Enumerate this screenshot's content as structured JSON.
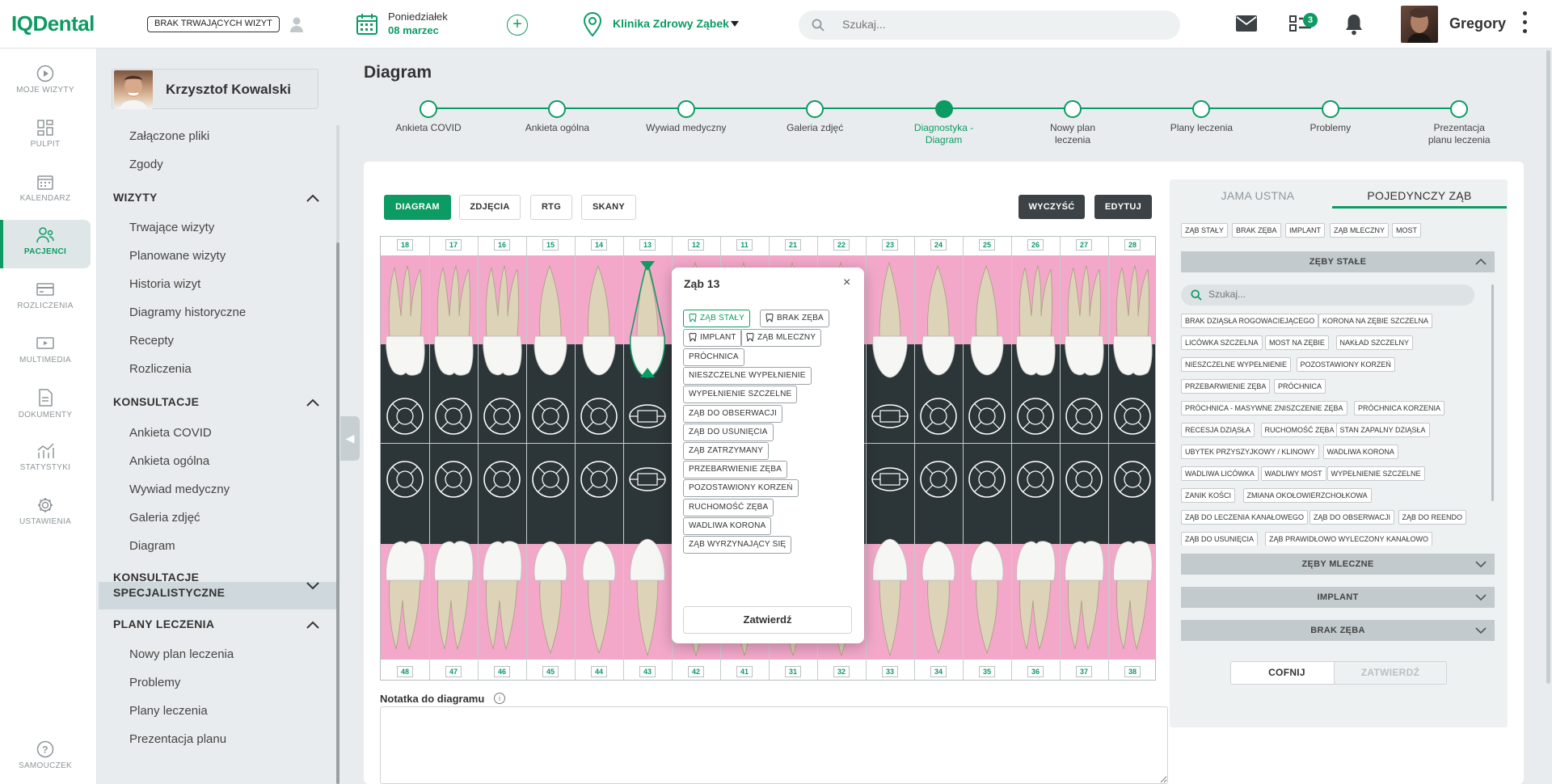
{
  "header": {
    "logo": "IQDental",
    "visit_badge": "BRAK TRWAJĄCYCH WIZYT",
    "date_day": "Poniedziałek",
    "date_date": "08 marzec",
    "add_symbol": "+",
    "clinic": "Klinika Zdrowy Ząbek",
    "search_placeholder": "Szukaj...",
    "tasks_count": "3",
    "user_name": "Gregory"
  },
  "nav": [
    {
      "label": "MOJE WIZYTY",
      "icon": "play-circle-icon"
    },
    {
      "label": "PULPIT",
      "icon": "dashboard-icon"
    },
    {
      "label": "KALENDARZ",
      "icon": "calendar-icon"
    },
    {
      "label": "PACJENCI",
      "icon": "patients-icon",
      "active": true
    },
    {
      "label": "ROZLICZENIA",
      "icon": "credit-card-icon"
    },
    {
      "label": "MULTIMEDIA",
      "icon": "multimedia-icon"
    },
    {
      "label": "DOKUMENTY",
      "icon": "document-icon"
    },
    {
      "label": "STATYSTYKI",
      "icon": "statistics-icon"
    },
    {
      "label": "USTAWIENIA",
      "icon": "gear-icon"
    },
    {
      "label": "SAMOUCZEK",
      "icon": "help-icon"
    }
  ],
  "patient": {
    "name": "Krzysztof Kowalski"
  },
  "menu": {
    "top_links": [
      "Załączone pliki",
      "Zgody"
    ],
    "wizyty": {
      "title": "WIZYTY",
      "items": [
        "Trwające wizyty",
        "Planowane wizyty",
        "Historia wizyt",
        "Diagramy historyczne",
        "Recepty",
        "Rozliczenia"
      ]
    },
    "konsultacje": {
      "title": "KONSULTACJE",
      "items": [
        "Ankieta COVID",
        "Ankieta ogólna",
        "Wywiad medyczny",
        "Galeria zdjęć",
        "Diagram"
      ]
    },
    "specjalistyczne": {
      "title": "KONSULTACJE SPECJALISTYCZNE"
    },
    "plany": {
      "title": "PLANY LECZENIA",
      "items": [
        "Nowy plan leczenia",
        "Problemy",
        "Plany leczenia",
        "Prezentacja planu"
      ]
    }
  },
  "page": {
    "title": "Diagram",
    "steps": [
      "Ankieta COVID",
      "Ankieta ogólna",
      "Wywiad medyczny",
      "Galeria zdjęć",
      "Diagnostyka - Diagram",
      "Nowy plan leczenia",
      "Plany leczenia",
      "Problemy",
      "Prezentacja planu leczenia"
    ],
    "active_step": 4
  },
  "view_tabs": [
    "DIAGRAM",
    "ZDJĘCIA",
    "RTG",
    "SKANY"
  ],
  "actions": {
    "clear": "WYCZYŚĆ",
    "edit": "EDYTUJ"
  },
  "chart": {
    "upper": [
      "18",
      "17",
      "16",
      "15",
      "14",
      "13",
      "12",
      "11",
      "21",
      "22",
      "23",
      "24",
      "25",
      "26",
      "27",
      "28"
    ],
    "lower": [
      "48",
      "47",
      "46",
      "45",
      "44",
      "43",
      "42",
      "41",
      "31",
      "32",
      "33",
      "34",
      "35",
      "36",
      "37",
      "38"
    ]
  },
  "popup": {
    "title": "Ząb 13",
    "close": "×",
    "types": [
      "ZĄB STAŁY",
      "BRAK ZĘBA",
      "IMPLANT",
      "ZĄB MLECZNY"
    ],
    "conditions": [
      "PRÓCHNICA",
      "NIESZCZELNE WYPEŁNIENIE",
      "WYPEŁNIENIE SZCZELNE",
      "ZĄB DO OBSERWACJI",
      "ZĄB DO USUNIĘCIA",
      "ZĄB ZATRZYMANY",
      "PRZEBARWIENIE ZĘBA",
      "POZOSTAWIONY KORZEŃ",
      "RUCHOMOŚĆ ZĘBA",
      "WADLIWA KORONA",
      "ZĄB WYRZYNAJĄCY SIĘ"
    ],
    "confirm": "Zatwierdź"
  },
  "note": {
    "label": "Notatka do diagramu",
    "info": "i"
  },
  "right_panel": {
    "tabs": [
      "JAMA USTNA",
      "POJEDYNCZY ZĄB"
    ],
    "type_chips": [
      "ZĄB STAŁY",
      "BRAK ZĘBA",
      "IMPLANT",
      "ZĄB MLECZNY",
      "MOST"
    ],
    "sections": [
      "ZĘBY STAŁE",
      "ZĘBY MLECZNE",
      "IMPLANT",
      "BRAK ZĘBA"
    ],
    "search_placeholder": "Szukaj...",
    "list": [
      [
        "BRAK DZIĄSŁA ROGOWACIEJĄCEGO",
        "KORONA NA ZĘBIE SZCZELNA"
      ],
      [
        "LICÓWKA SZCZELNA",
        "MOST NA ZĘBIE",
        "NAKŁAD SZCZELNY"
      ],
      [
        "NIESZCZELNE WYPEŁNIENIE",
        "POZOSTAWIONY KORZEŃ"
      ],
      [
        "PRZEBARWIENIE ZĘBA",
        "PRÓCHNICA"
      ],
      [
        "PRÓCHNICA - MASYWNE ZNISZCZENIE ZĘBA",
        "PRÓCHNICA KORZENIA"
      ],
      [
        "RECESJA DZIĄSŁA",
        "RUCHOMOŚĆ ZĘBA",
        "STAN ZAPALNY DZIĄSŁA"
      ],
      [
        "UBYTEK PRZYSZYJKOWY / KLINOWY",
        "WADLIWA KORONA"
      ],
      [
        "WADLIWA LICÓWKA",
        "WADLIWY MOST",
        "WYPEŁNIENIE SZCZELNE"
      ],
      [
        "ZANIK KOŚCI",
        "ZMIANA OKOŁOWIERZCHOŁKOWA"
      ],
      [
        "ZĄB DO LECZENIA KANAŁOWEGO",
        "ZĄB DO OBSERWACJI",
        "ZĄB DO REENDO"
      ],
      [
        "ZĄB DO USUNIĘCIA",
        "ZĄB PRAWIDŁOWO WYLECZONY KANAŁOWO"
      ]
    ],
    "back": "COFNIJ",
    "confirm": "ZATWIERDŹ"
  },
  "colors": {
    "accent": "#0c9b63",
    "gum": "#f3a8c9",
    "dark": "#2c3538"
  }
}
